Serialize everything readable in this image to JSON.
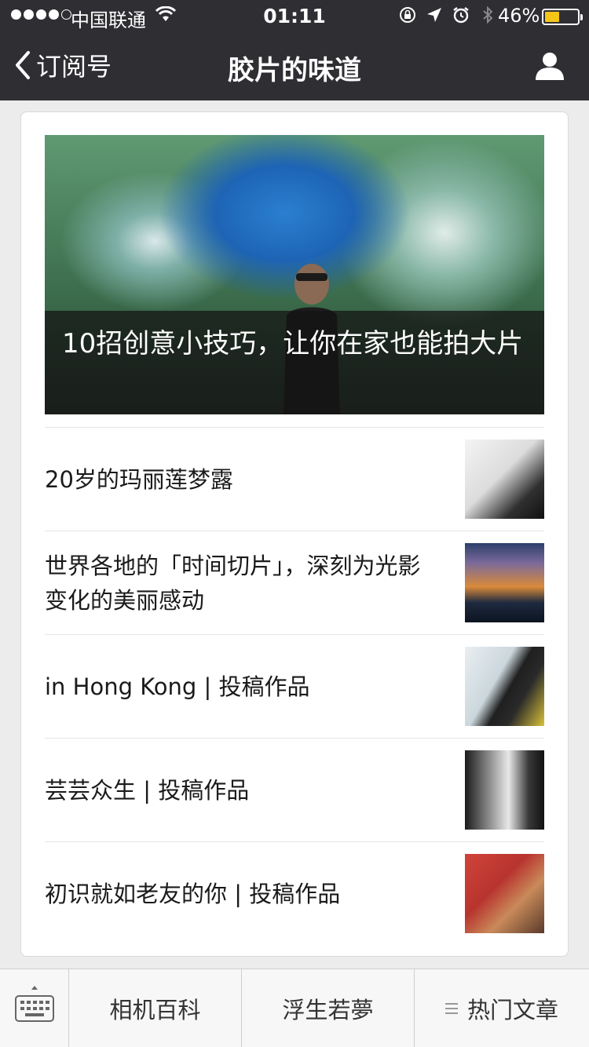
{
  "status_bar": {
    "carrier": "中国联通",
    "time": "01:11",
    "battery_percent": "46%",
    "battery_level": 0.46
  },
  "nav": {
    "back_label": "订阅号",
    "title": "胶片的味道"
  },
  "featured": {
    "title": "10招创意小技巧，让你在家也能拍大片"
  },
  "articles": [
    {
      "title": "20岁的玛丽莲梦露"
    },
    {
      "title": "世界各地的「时间切片」，深刻为光影变化的美丽感动"
    },
    {
      "title": "in Hong Kong | 投稿作品"
    },
    {
      "title": "芸芸众生 | 投稿作品"
    },
    {
      "title": "初识就如老友的你 | 投稿作品"
    }
  ],
  "bottom_menu": {
    "items": [
      "相机百科",
      "浮生若夢",
      "热门文章"
    ]
  },
  "colors": {
    "nav_bg": "#2e2e33",
    "battery": "#f5c518"
  }
}
